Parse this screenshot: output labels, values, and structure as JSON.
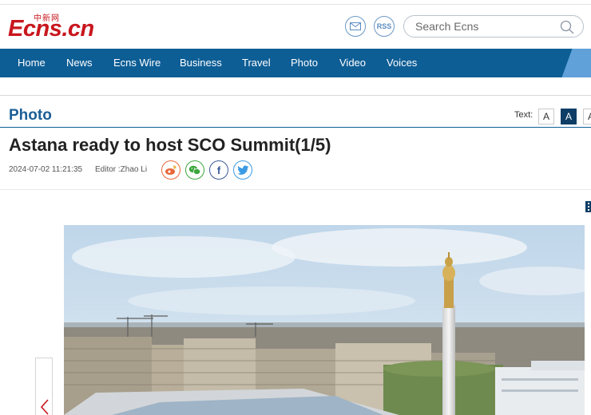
{
  "site": {
    "logo_text": "Ecns.cn",
    "logo_chinese": "中新网",
    "search_placeholder": "Search Ecns",
    "rss_label": "RSS"
  },
  "nav": {
    "items": [
      "Home",
      "News",
      "Ecns Wire",
      "Business",
      "Travel",
      "Photo",
      "Video",
      "Voices"
    ]
  },
  "section": {
    "title": "Photo",
    "text_size_label": "Text:",
    "text_size_options": [
      "A",
      "A",
      "A"
    ],
    "active_size_index": 1
  },
  "article": {
    "headline": "Astana ready to host SCO Summit(1/5)",
    "date": "2024-07-02 11:21:35",
    "editor": "Editor :Zhao Li"
  },
  "share": [
    "weibo-icon",
    "wechat-icon",
    "facebook-icon",
    "twitter-icon"
  ],
  "colors": {
    "brand_red": "#c8161d",
    "nav_blue": "#0e5e96",
    "section_blue": "#1b5f97",
    "active_size": "#0e3e66"
  },
  "photo": {
    "subject": "Astana city skyline with tall white monument column and golden statue"
  }
}
